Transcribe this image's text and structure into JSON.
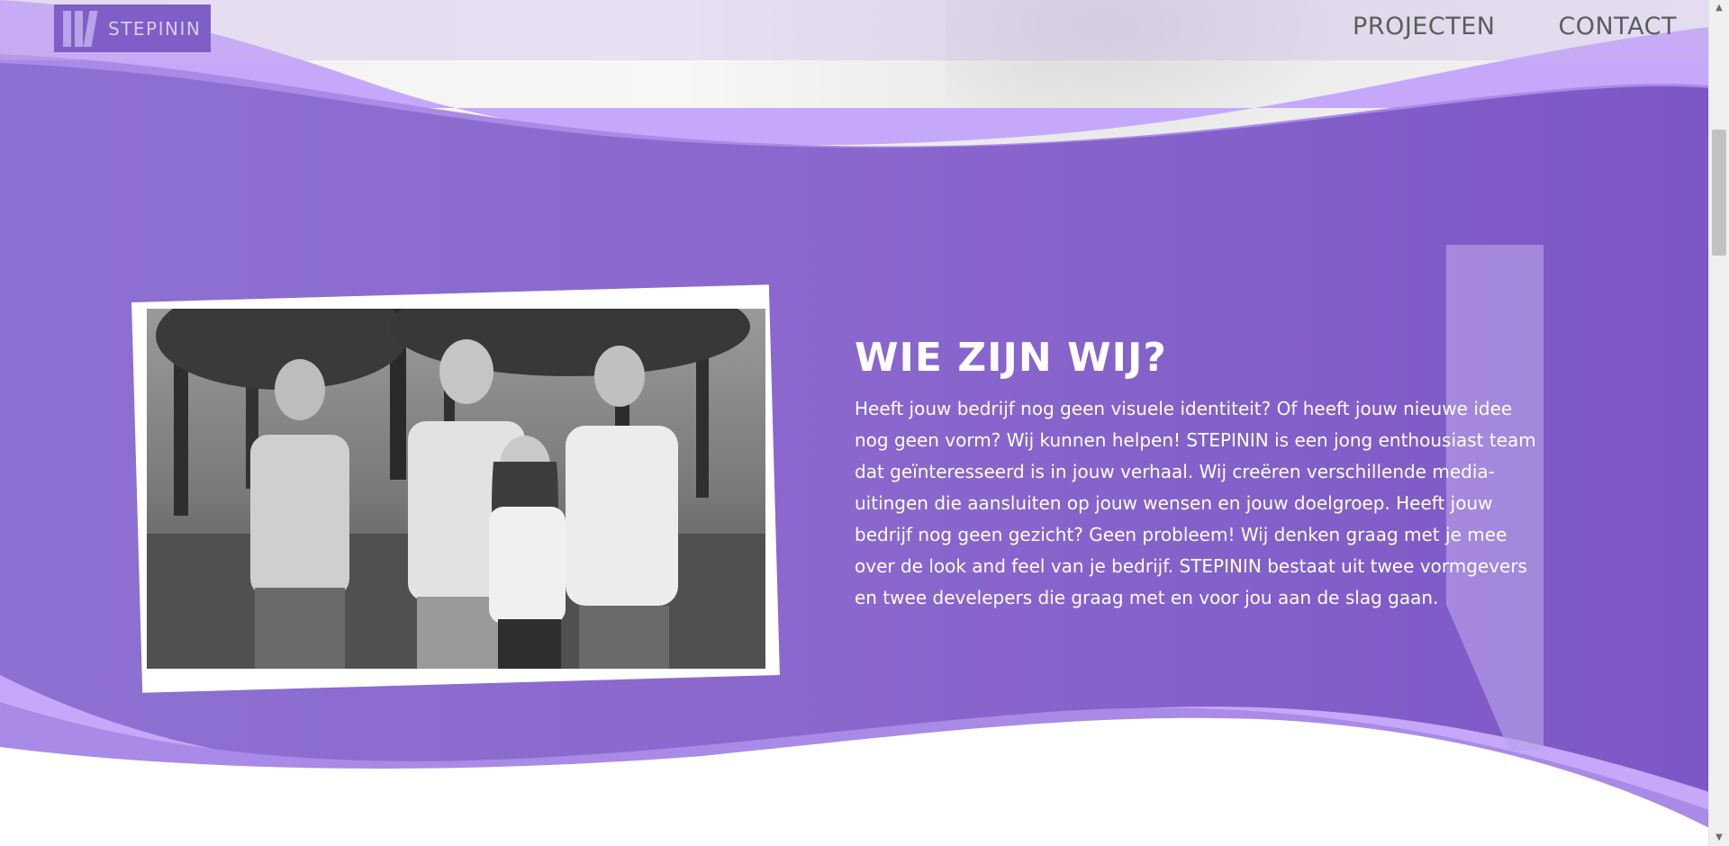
{
  "header": {
    "logo_text": "STEPININ",
    "nav": [
      {
        "label": "PROJECTEN"
      },
      {
        "label": "CONTACT"
      }
    ]
  },
  "about": {
    "title": "WIE ZIJN WIJ?",
    "body": "Heeft jouw bedrijf nog geen visuele identiteit? Of heeft jouw nieuwe idee nog geen vorm? Wij kunnen helpen! STEPININ is een jong enthousiast team dat geïnteresseerd is in jouw verhaal. Wij creëren verschillende media-uitingen die aansluiten op jouw wensen en jouw doelgroep. Heeft jouw bedrijf nog geen gezicht? Geen probleem! Wij denken graag met je mee over de look and feel van je bedrijf. STEPININ bestaat uit twee vormgevers en twee develepers die graag met en voor jou aan de slag gaan.",
    "photo_icon": "team-photo"
  },
  "colors": {
    "purple_main": "#8a68cc",
    "purple_light": "#c6a8fb",
    "purple_wave": "#a98ae6",
    "logo_bg": "#7f5ec7",
    "nav_text": "#5c5c5c"
  }
}
